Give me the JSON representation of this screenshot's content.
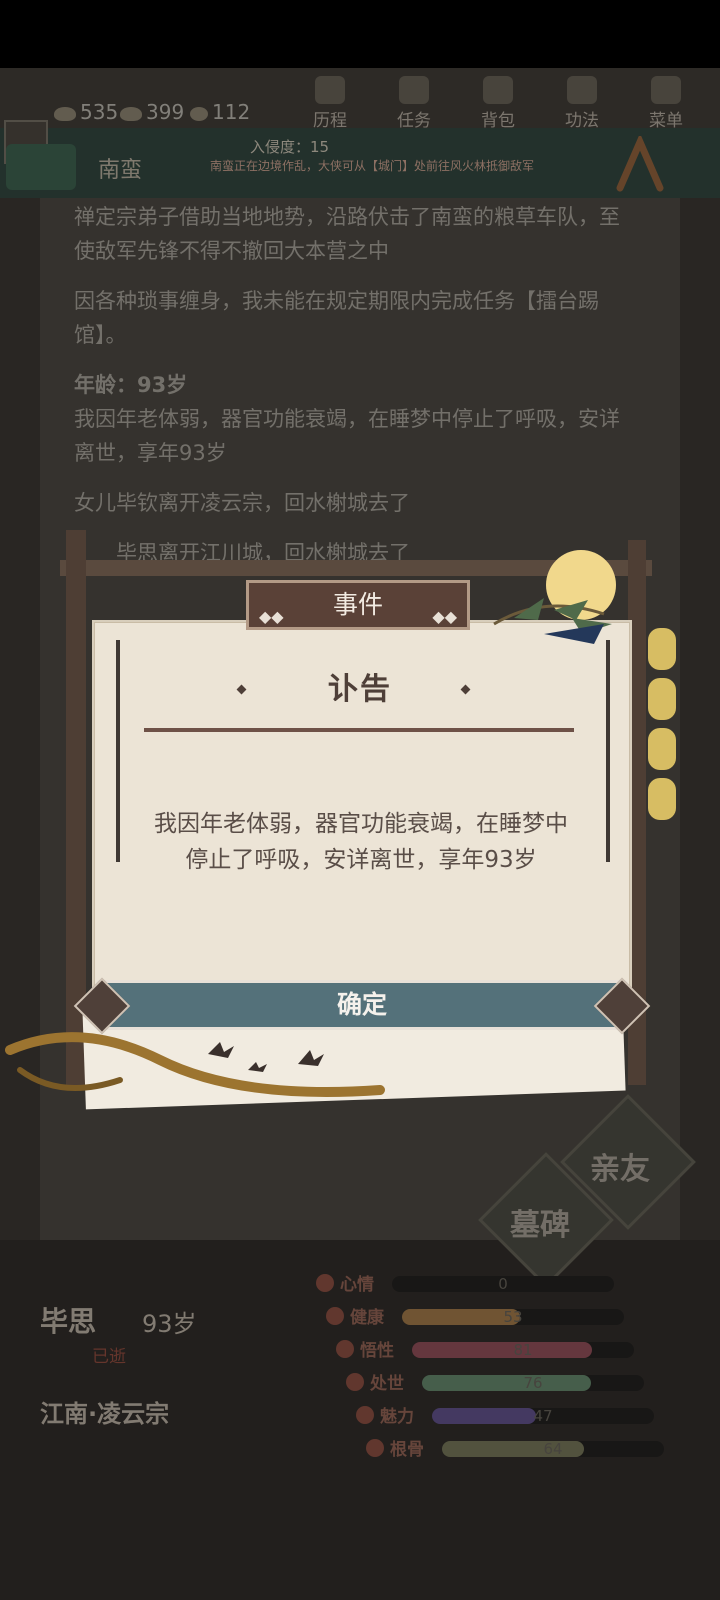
{
  "resources": {
    "coin": "535",
    "silver": "399",
    "token": "112"
  },
  "nav": [
    {
      "label": "历程",
      "icon": "journey-icon"
    },
    {
      "label": "任务",
      "icon": "task-icon"
    },
    {
      "label": "背包",
      "icon": "bag-icon"
    },
    {
      "label": "功法",
      "icon": "book-icon"
    },
    {
      "label": "菜单",
      "icon": "fan-menu-icon"
    }
  ],
  "invasion": "入侵度：15",
  "region": "南蛮",
  "notice": "南蛮正在边境作乱，大侠可从【城门】处前往风火林抵御敌军",
  "log": {
    "p1": "禅定宗弟子借助当地地势，沿路伏击了南蛮的粮草车队，至使敌军先锋不得不撤回大本营之中",
    "p2": "因各种琐事缠身，我未能在规定期限内完成任务【擂台踢馆】。",
    "age": "年龄：93岁",
    "p3": "我因年老体弱，器官功能衰竭，在睡梦中停止了呼吸，安详离世，享年93岁",
    "p4": "女儿毕钦离开凌云宗，回水榭城去了",
    "p5": "　　毕思离开江川城，回水榭城去了"
  },
  "dialog": {
    "tag": "事件",
    "title": "讣告",
    "body": "我因年老体弱，器官功能衰竭，在睡梦中停止了呼吸，安详离世，享年93岁",
    "confirm": "确定"
  },
  "character": {
    "name": "毕思",
    "age": "93岁",
    "status": "已逝",
    "location": "江南·凌云宗"
  },
  "buttons": {
    "friends": "亲友",
    "tomb": "墓碑"
  },
  "stats": [
    {
      "name": "心情",
      "value": "0",
      "level": 0.0,
      "color": "#4a3f38"
    },
    {
      "name": "健康",
      "value": "53",
      "level": 0.53,
      "color": "#7a5c38"
    },
    {
      "name": "悟性",
      "value": "81",
      "level": 0.81,
      "color": "#6e3c44"
    },
    {
      "name": "处世",
      "value": "76",
      "level": 0.76,
      "color": "#4d6652"
    },
    {
      "name": "魅力",
      "value": "47",
      "level": 0.47,
      "color": "#4a3e6a"
    },
    {
      "name": "根骨",
      "value": "64",
      "level": 0.64,
      "color": "#5a5a44"
    }
  ]
}
